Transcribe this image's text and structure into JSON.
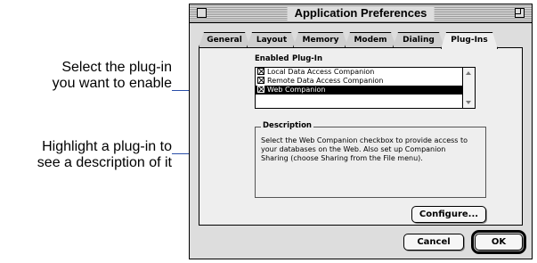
{
  "callouts": {
    "enable": [
      "Select the plug-in",
      "you want to enable"
    ],
    "describe": [
      "Highlight a plug-in to",
      "see a description of it"
    ],
    "line_color": "#2a4fa8"
  },
  "window": {
    "title": "Application Preferences",
    "tabs": [
      "General",
      "Layout",
      "Memory",
      "Modem",
      "Dialing",
      "Plug-Ins"
    ],
    "active_tab": "Plug-Ins"
  },
  "plugins": {
    "headers": {
      "enabled": "Enabled",
      "plugin": "Plug-In"
    },
    "items": [
      {
        "label": "Local Data Access Companion",
        "enabled": true,
        "selected": false
      },
      {
        "label": "Remote Data Access Companion",
        "enabled": true,
        "selected": false
      },
      {
        "label": "Web Companion",
        "enabled": true,
        "selected": true
      }
    ]
  },
  "description": {
    "label": "Description",
    "text": "Select the Web Companion checkbox to provide access to your databases on the Web. Also set up Companion Sharing (choose Sharing from the File menu)."
  },
  "buttons": {
    "configure": "Configure...",
    "cancel": "Cancel",
    "ok": "OK"
  },
  "icons": [
    "close-box-icon",
    "zoom-box-icon",
    "scroll-up-arrow-icon",
    "scroll-down-arrow-icon",
    "checkbox-checked-icon"
  ]
}
